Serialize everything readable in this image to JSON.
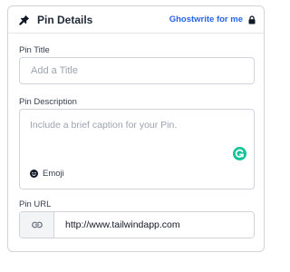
{
  "header": {
    "title": "Pin Details",
    "pin_icon": "pin-icon",
    "ghostwrite_label": "Ghostwrite for me",
    "lock_icon": "lock-icon"
  },
  "pin_title": {
    "label": "Pin Title",
    "placeholder": "Add a Title",
    "value": ""
  },
  "pin_description": {
    "label": "Pin Description",
    "placeholder": "Include a brief caption for your Pin.",
    "value": "",
    "emoji_label": "Emoji",
    "emoji_icon": "smiley-icon",
    "assistant_icon": "grammarly-icon"
  },
  "pin_url": {
    "label": "Pin URL",
    "prefix_icon": "link-icon",
    "value": "http://www.tailwindapp.com"
  },
  "colors": {
    "accent": "#2563eb",
    "grammarly": "#15c39a",
    "border": "#d1d5db"
  }
}
